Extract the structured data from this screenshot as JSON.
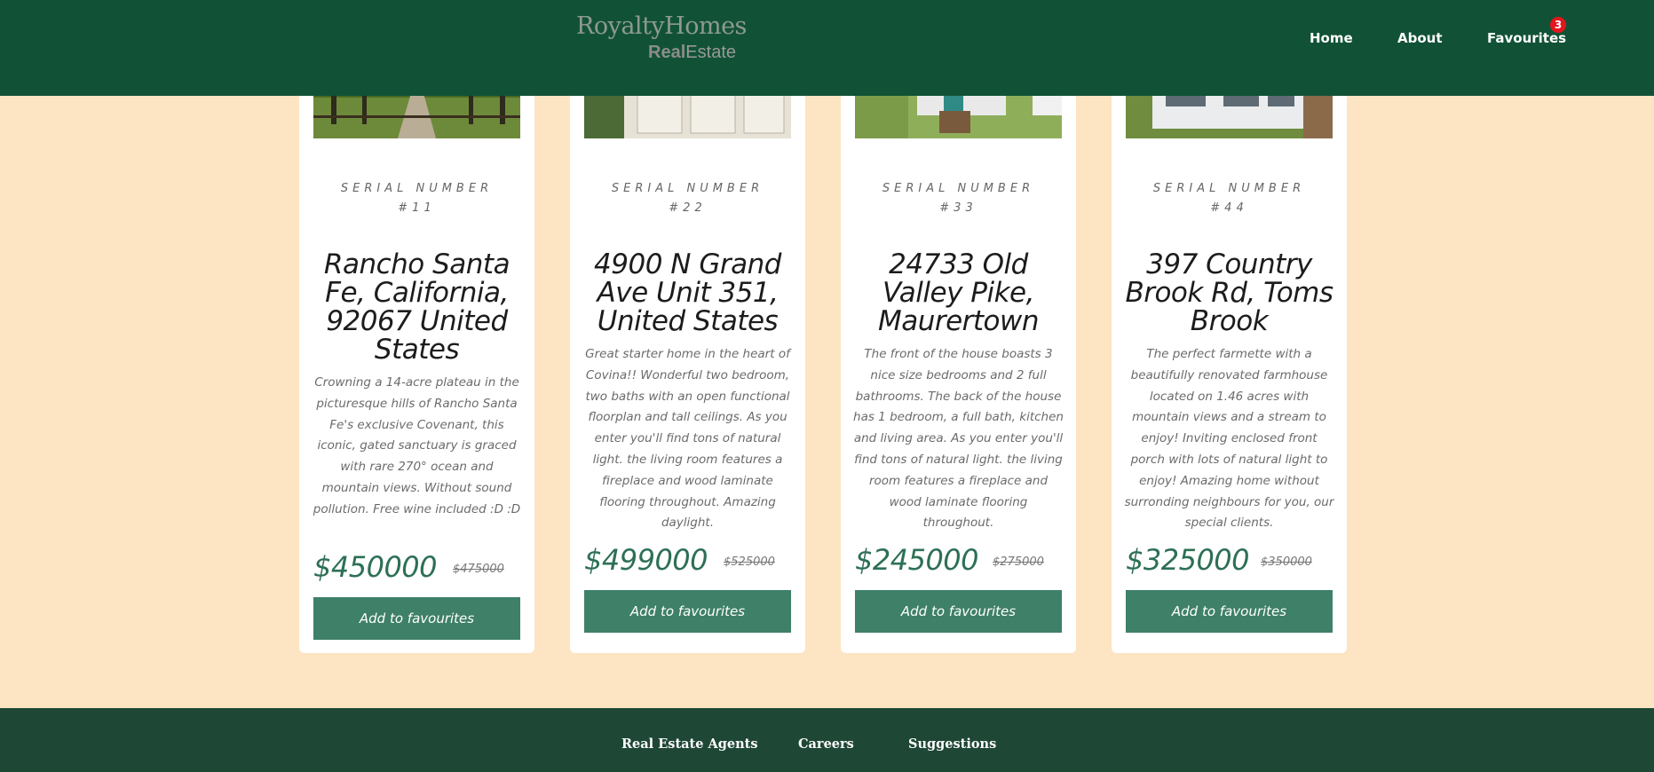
{
  "brand": {
    "line1": "RoyaltyHomes",
    "line2a": "Real",
    "line2b": "Estate"
  },
  "nav": {
    "home": "Home",
    "about": "About",
    "favourites": "Favourites",
    "favourites_count": "3"
  },
  "cards": [
    {
      "serial_label": "SERIAL NUMBER",
      "serial_number": "#11",
      "title": "Rancho Santa Fe, California, 92067 United States",
      "description": "Crowning a 14-acre plateau in the picturesque hills of Rancho Santa Fe's exclusive Covenant, this iconic, gated sanctuary is graced with rare 270° ocean and mountain views. Without sound pollution. Free wine included :D :D",
      "price": "$450000",
      "old_price": "$475000",
      "button": "Add to favourites"
    },
    {
      "serial_label": "SERIAL NUMBER",
      "serial_number": "#22",
      "title": "4900 N Grand Ave Unit 351, United States",
      "description": "Great starter home in the heart of Covina!! Wonderful two bedroom, two baths with an open functional floorplan and tall ceilings. As you enter you'll find tons of natural light. the living room features a fireplace and wood laminate flooring throughout. Amazing daylight.",
      "price": "$499000",
      "old_price": "$525000",
      "button": "Add to favourites"
    },
    {
      "serial_label": "SERIAL NUMBER",
      "serial_number": "#33",
      "title": "24733 Old Valley Pike, Maurertown",
      "description": "The front of the house boasts 3 nice size bedrooms and 2 full bathrooms. The back of the house has 1 bedroom, a full bath, kitchen and living area. As you enter you'll find tons of natural light. the living room features a fireplace and wood laminate flooring throughout.",
      "price": "$245000",
      "old_price": "$275000",
      "button": "Add to favourites"
    },
    {
      "serial_label": "SERIAL NUMBER",
      "serial_number": "#44",
      "title": "397 Country Brook Rd, Toms Brook",
      "description": "The perfect farmette with a beautifully renovated farmhouse located on 1.46 acres with mountain views and a stream to enjoy! Inviting enclosed front porch with lots of natural light to enjoy! Amazing home without surronding neighbours for you, our special clients.",
      "price": "$325000",
      "old_price": "$350000",
      "button": "Add to favourites"
    }
  ],
  "footer": {
    "agents": "Real Estate Agents",
    "careers": "Careers",
    "suggestions": "Suggestions"
  },
  "colors": {
    "nav_bg": "#115236",
    "page_bg": "#fde4c3",
    "accent": "#3e8068",
    "price": "#2d7055",
    "footer_bg": "#1f4736",
    "badge": "#e2161c"
  }
}
